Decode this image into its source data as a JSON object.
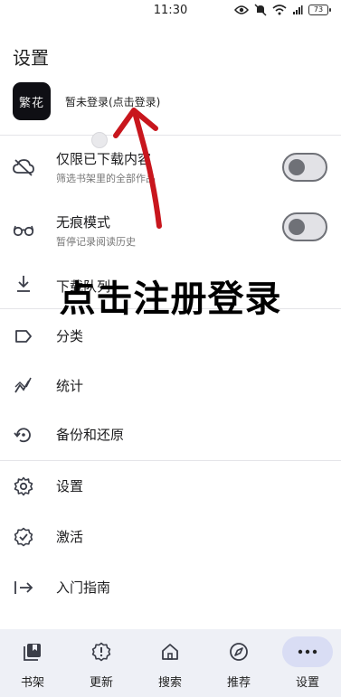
{
  "status_bar": {
    "time": "11:30",
    "battery": "73"
  },
  "page_title": "设置",
  "account": {
    "logo_text": "繁花",
    "login_text": "暂未登录(点击登录)"
  },
  "rows": {
    "downloaded_only": {
      "label": "仅限已下载内容",
      "sub": "筛选书架里的全部作品",
      "toggle": false
    },
    "incognito": {
      "label": "无痕模式",
      "sub": "暂停记录阅读历史",
      "toggle": false
    },
    "download_queue": {
      "label": "下载队列"
    },
    "categories": {
      "label": "分类"
    },
    "stats": {
      "label": "统计"
    },
    "backup": {
      "label": "备份和还原"
    },
    "settings": {
      "label": "设置"
    },
    "activate": {
      "label": "激活"
    },
    "guide": {
      "label": "入门指南"
    }
  },
  "overlay_caption": "点击注册登录",
  "bottom_nav": {
    "bookshelf": "书架",
    "updates": "更新",
    "search": "搜索",
    "recommend": "推荐",
    "settings": "设置"
  },
  "colors": {
    "arrow": "#c8161d",
    "nav_bg": "#eef0f6",
    "nav_active": "#d9ddf4"
  }
}
